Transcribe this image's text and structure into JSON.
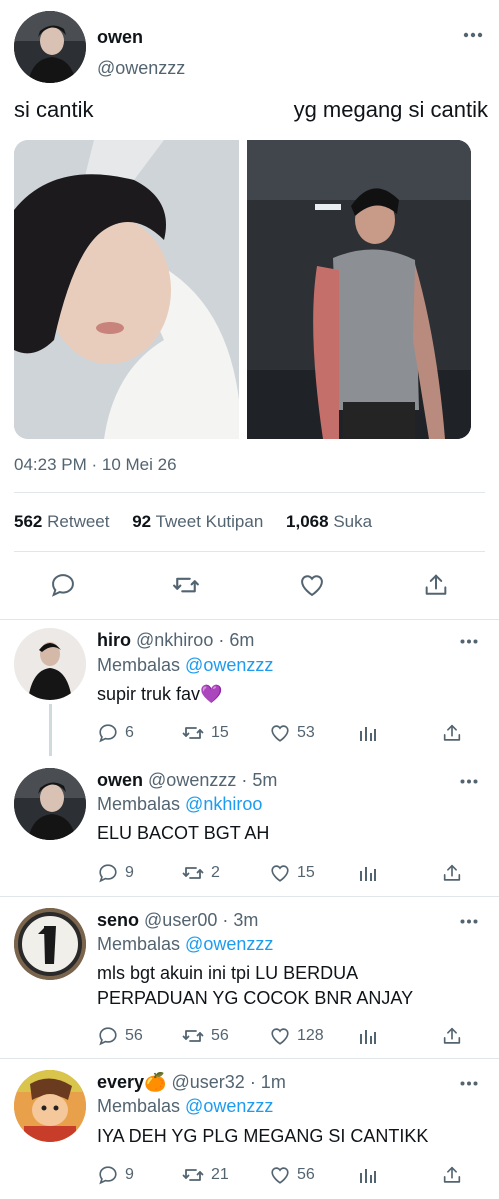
{
  "tweet": {
    "author_name": "owen",
    "author_handle": "@owenzzz",
    "caption_left": "si cantik",
    "caption_right": "yg megang si cantik",
    "timestamp": "04:23 PM · 10 Mei 26",
    "stats": {
      "retweets_count": "562",
      "retweets_label": "Retweet",
      "quotes_count": "92",
      "quotes_label": "Tweet Kutipan",
      "likes_count": "1,068",
      "likes_label": "Suka"
    },
    "actions": [
      "reply-icon",
      "retweet-icon",
      "like-icon",
      "share-icon"
    ]
  },
  "replies": [
    {
      "name": "hiro",
      "handle": "@nkhiroo",
      "time": "· 6m",
      "replying_prefix": "Membalas",
      "replying_to": "@owenzzz",
      "text": "supir truk fav💜",
      "replies": "6",
      "retweets": "15",
      "likes": "53"
    },
    {
      "name": "owen",
      "handle": "@owenzzz",
      "time": "· 5m",
      "replying_prefix": "Membalas",
      "replying_to": "@nkhiroo",
      "text": "ELU BACOT BGT AH",
      "replies": "9",
      "retweets": "2",
      "likes": "15"
    },
    {
      "name": "seno",
      "handle": "@user00",
      "time": "· 3m",
      "replying_prefix": "Membalas",
      "replying_to": "@owenzzz",
      "text_line1": "mls bgt akuin ini tpi LU BERDUA",
      "text_line2": "PERPADUAN YG COCOK BNR ANJAY",
      "replies": "56",
      "retweets": "56",
      "likes": "128"
    },
    {
      "name": "every🍊",
      "handle": "@user32",
      "time": "· 1m",
      "replying_prefix": "Membalas",
      "replying_to": "@owenzzz",
      "text": "IYA DEH YG PLG MEGANG SI CANTIKK",
      "replies": "9",
      "retweets": "21",
      "likes": "56"
    }
  ],
  "colors": {
    "text": "#0f1419",
    "secondary": "#536471",
    "link": "#1d9bf0",
    "divider": "#e1e6ea"
  }
}
